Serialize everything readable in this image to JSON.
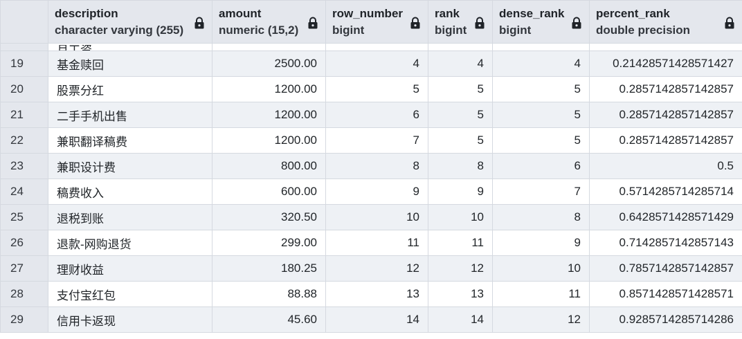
{
  "columns": [
    {
      "name": "description",
      "type": "character varying (255)"
    },
    {
      "name": "amount",
      "type": "numeric (15,2)"
    },
    {
      "name": "row_number",
      "type": "bigint"
    },
    {
      "name": "rank",
      "type": "bigint"
    },
    {
      "name": "dense_rank",
      "type": "bigint"
    },
    {
      "name": "percent_rank",
      "type": "double precision"
    }
  ],
  "partial_row": {
    "description": "月工资"
  },
  "rows": [
    {
      "n": "19",
      "description": "基金赎回",
      "amount": "2500.00",
      "row_number": "4",
      "rank": "4",
      "dense_rank": "4",
      "percent_rank": "0.21428571428571427"
    },
    {
      "n": "20",
      "description": "股票分红",
      "amount": "1200.00",
      "row_number": "5",
      "rank": "5",
      "dense_rank": "5",
      "percent_rank": "0.2857142857142857"
    },
    {
      "n": "21",
      "description": "二手手机出售",
      "amount": "1200.00",
      "row_number": "6",
      "rank": "5",
      "dense_rank": "5",
      "percent_rank": "0.2857142857142857"
    },
    {
      "n": "22",
      "description": "兼职翻译稿费",
      "amount": "1200.00",
      "row_number": "7",
      "rank": "5",
      "dense_rank": "5",
      "percent_rank": "0.2857142857142857"
    },
    {
      "n": "23",
      "description": "兼职设计费",
      "amount": "800.00",
      "row_number": "8",
      "rank": "8",
      "dense_rank": "6",
      "percent_rank": "0.5"
    },
    {
      "n": "24",
      "description": "稿费收入",
      "amount": "600.00",
      "row_number": "9",
      "rank": "9",
      "dense_rank": "7",
      "percent_rank": "0.5714285714285714"
    },
    {
      "n": "25",
      "description": "退税到账",
      "amount": "320.50",
      "row_number": "10",
      "rank": "10",
      "dense_rank": "8",
      "percent_rank": "0.6428571428571429"
    },
    {
      "n": "26",
      "description": "退款-网购退货",
      "amount": "299.00",
      "row_number": "11",
      "rank": "11",
      "dense_rank": "9",
      "percent_rank": "0.7142857142857143"
    },
    {
      "n": "27",
      "description": "理财收益",
      "amount": "180.25",
      "row_number": "12",
      "rank": "12",
      "dense_rank": "10",
      "percent_rank": "0.7857142857142857"
    },
    {
      "n": "28",
      "description": "支付宝红包",
      "amount": "88.88",
      "row_number": "13",
      "rank": "13",
      "dense_rank": "11",
      "percent_rank": "0.8571428571428571"
    },
    {
      "n": "29",
      "description": "信用卡返现",
      "amount": "45.60",
      "row_number": "14",
      "rank": "14",
      "dense_rank": "12",
      "percent_rank": "0.9285714285714286"
    }
  ]
}
